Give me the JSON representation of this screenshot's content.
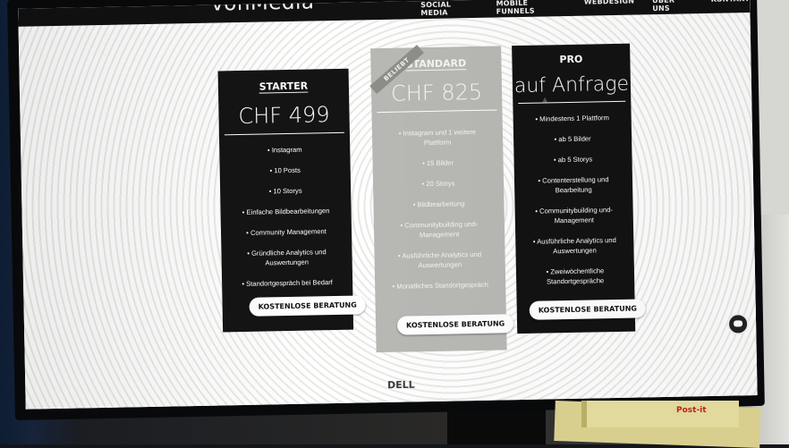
{
  "brand": {
    "logo": "vonMedia"
  },
  "nav": [
    "SOCIAL MEDIA",
    "MOBILE FUNNELS",
    "WEBDESIGN",
    "ÜBER UNS",
    "KONTAKT"
  ],
  "plans": [
    {
      "title": "STARTER",
      "price": "CHF 499",
      "features": [
        "Instagram",
        "10 Posts",
        "10 Storys",
        "Einfache Bildbearbeitungen",
        "Community Management",
        "Gründliche Analytics und Auswertungen",
        "Standortgespräch bei Bedarf"
      ],
      "cta": "KOSTENLOSE BERATUNG"
    },
    {
      "title": "STANDARD",
      "badge": "BELIEBT",
      "price": "CHF 825",
      "features": [
        "Instagram und 1 weitere Plattform",
        "15 Bilder",
        "20 Storys",
        "Bildbearbeitung",
        "Communitybuilding und-Management",
        "Ausführliche Analytics und Auswertungen",
        "Monatliches Standortgespräch"
      ],
      "cta": "KOSTENLOSE BERATUNG"
    },
    {
      "title": "PRO",
      "price": "auf Anfrage",
      "features": [
        "Mindestens 1 Plattform",
        "ab 5 Bilder",
        "ab 5 Storys",
        "Contenterstellung und Bearbeitung",
        "Communitybuilding und-Management",
        "Ausführliche Analytics und Auswertungen",
        "Zweiwöchentliche Standortgespräche"
      ],
      "cta": "KOSTENLOSE BERATUNG"
    }
  ],
  "hardware": {
    "monitor_brand": "DELL",
    "sticky_note": "Post-it"
  },
  "colors": {
    "dark_card": "#141414",
    "standard_card": "#b8b8b4",
    "page_bg": "#f3f3f0",
    "header_bg": "#111111"
  }
}
